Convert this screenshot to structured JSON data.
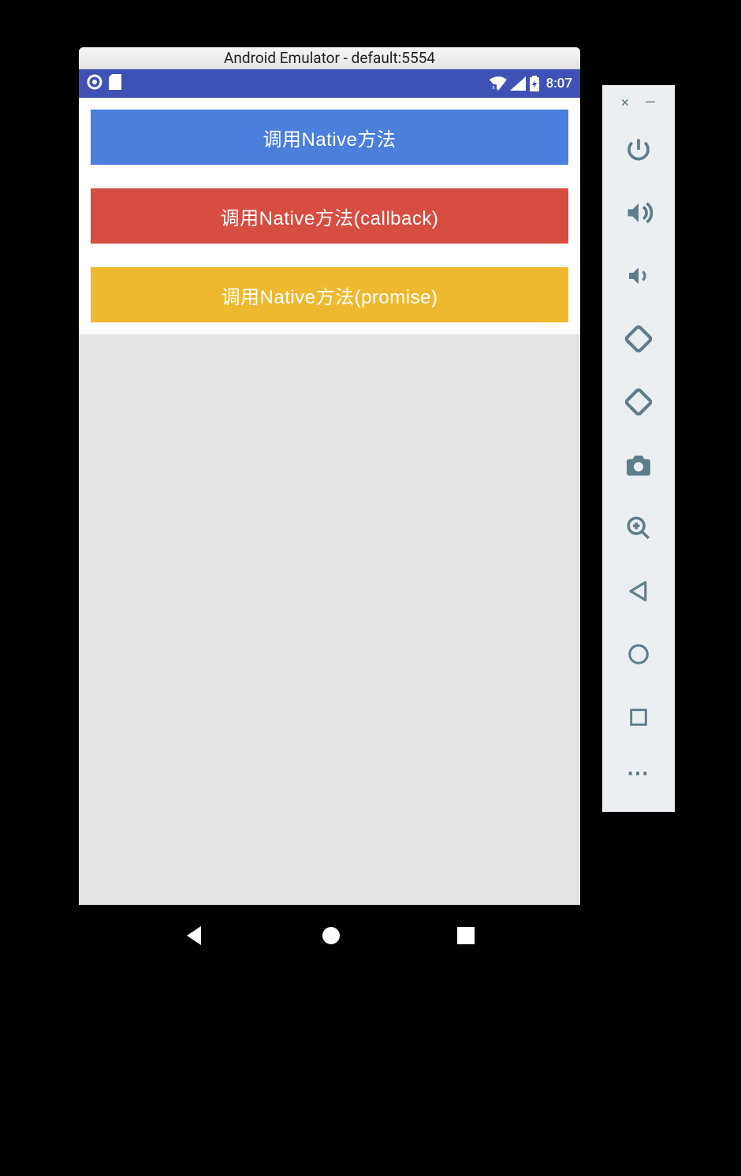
{
  "window": {
    "title": "Android Emulator - default:5554"
  },
  "statusbar": {
    "time": "8:07"
  },
  "buttons": [
    {
      "label": "调用Native方法",
      "color": "blue"
    },
    {
      "label": "调用Native方法(callback)",
      "color": "red"
    },
    {
      "label": "调用Native方法(promise)",
      "color": "yellow"
    }
  ],
  "toolbar": {
    "close": "×",
    "minimize": "—",
    "more": "⋯",
    "icons": [
      "power",
      "volume-up",
      "volume-down",
      "rotate-left",
      "rotate-right",
      "camera",
      "zoom",
      "back",
      "home",
      "overview"
    ]
  },
  "nav": [
    "back",
    "home",
    "overview"
  ],
  "colors": {
    "primary": "#3F51B5",
    "blue": "#4A7FDB",
    "red": "#D74D3F",
    "yellow": "#EEB92F",
    "toolbar_icon": "#607D8B"
  }
}
